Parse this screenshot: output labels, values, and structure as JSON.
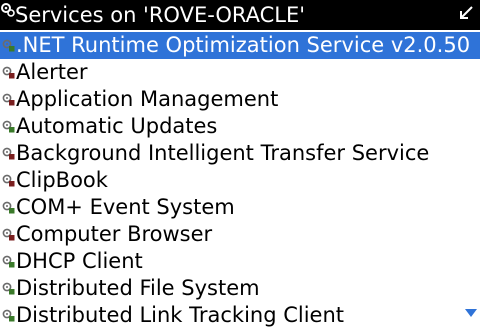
{
  "header": {
    "title": "Services on 'ROVE-ORACLE'",
    "app_icon": "gears-icon",
    "back_icon": "back-arrow-icon"
  },
  "colors": {
    "header_bg": "#000000",
    "selection_bg": "#2f73d8",
    "running_icon": "#7a1f1f",
    "stopped_icon": "#3a7a2a",
    "scroll_indicator": "#2f73d8"
  },
  "services": [
    {
      "label": ".NET Runtime Optimization Service v2.0.50",
      "icon": "service-stopped-icon",
      "selected": true
    },
    {
      "label": "Alerter",
      "icon": "service-running-icon"
    },
    {
      "label": "Application Management",
      "icon": "service-running-icon"
    },
    {
      "label": "Automatic Updates",
      "icon": "service-stopped-icon"
    },
    {
      "label": "Background Intelligent Transfer Service",
      "icon": "service-running-icon"
    },
    {
      "label": "ClipBook",
      "icon": "service-running-icon"
    },
    {
      "label": "COM+ Event System",
      "icon": "service-stopped-icon"
    },
    {
      "label": "Computer Browser",
      "icon": "service-running-icon"
    },
    {
      "label": "DHCP Client",
      "icon": "service-stopped-icon"
    },
    {
      "label": "Distributed File System",
      "icon": "service-stopped-icon"
    },
    {
      "label": "Distributed Link Tracking Client",
      "icon": "service-stopped-icon"
    }
  ],
  "scroll_indicator_icon": "scroll-down-arrow-icon"
}
